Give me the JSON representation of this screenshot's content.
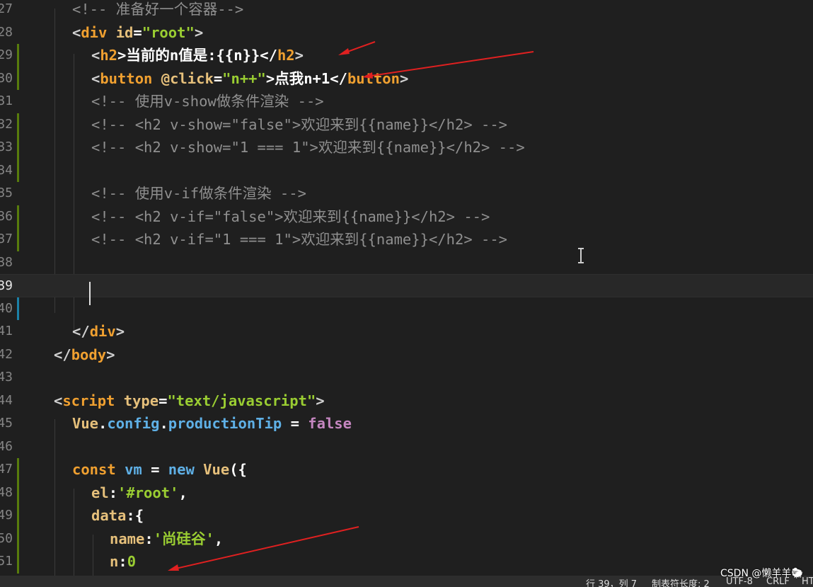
{
  "editor": {
    "lines": [
      {
        "num": "27",
        "tokens": [
          {
            "t": "<!-- 准备好一个容器-->",
            "c": "c"
          }
        ]
      },
      {
        "num": "28",
        "tokens": [
          {
            "t": "<",
            "c": "p"
          },
          {
            "t": "div",
            "c": "t"
          },
          {
            "t": " ",
            "c": "w"
          },
          {
            "t": "id",
            "c": "a"
          },
          {
            "t": "=",
            "c": "w"
          },
          {
            "t": "\"root\"",
            "c": "s"
          },
          {
            "t": ">",
            "c": "p"
          }
        ]
      },
      {
        "num": "29",
        "tokens": [
          {
            "t": "<",
            "c": "p"
          },
          {
            "t": "h2",
            "c": "t"
          },
          {
            "t": ">当前的n值是:{{n}}</",
            "c": "w"
          },
          {
            "t": "h2",
            "c": "t"
          },
          {
            "t": ">",
            "c": "p"
          }
        ]
      },
      {
        "num": "30",
        "tokens": [
          {
            "t": "<",
            "c": "p"
          },
          {
            "t": "button",
            "c": "t"
          },
          {
            "t": " ",
            "c": "w"
          },
          {
            "t": "@click",
            "c": "a"
          },
          {
            "t": "=",
            "c": "w"
          },
          {
            "t": "\"n++\"",
            "c": "s"
          },
          {
            "t": ">点我n+1</",
            "c": "w"
          },
          {
            "t": "button",
            "c": "t"
          },
          {
            "t": ">",
            "c": "p"
          }
        ]
      },
      {
        "num": "31",
        "tokens": [
          {
            "t": "<!-- 使用v-show做条件渲染 -->",
            "c": "c"
          }
        ]
      },
      {
        "num": "32",
        "tokens": [
          {
            "t": "<!-- <h2 v-show=\"false\">欢迎来到{{name}}</h2> -->",
            "c": "c"
          }
        ]
      },
      {
        "num": "33",
        "tokens": [
          {
            "t": "<!-- <h2 v-show=\"1 === 1\">欢迎来到{{name}}</h2> -->",
            "c": "c"
          }
        ]
      },
      {
        "num": "34",
        "tokens": []
      },
      {
        "num": "35",
        "tokens": [
          {
            "t": "<!-- 使用v-if做条件渲染 -->",
            "c": "c"
          }
        ]
      },
      {
        "num": "36",
        "tokens": [
          {
            "t": "<!-- <h2 v-if=\"false\">欢迎来到{{name}}</h2> -->",
            "c": "c"
          }
        ]
      },
      {
        "num": "37",
        "tokens": [
          {
            "t": "<!-- <h2 v-if=\"1 === 1\">欢迎来到{{name}}</h2> -->",
            "c": "c"
          }
        ]
      },
      {
        "num": "38",
        "tokens": []
      },
      {
        "num": "39",
        "tokens": []
      },
      {
        "num": "40",
        "tokens": []
      },
      {
        "num": "41",
        "tokens": [
          {
            "t": "</",
            "c": "p"
          },
          {
            "t": "div",
            "c": "t"
          },
          {
            "t": ">",
            "c": "p"
          }
        ]
      },
      {
        "num": "42",
        "tokens": [
          {
            "t": "</",
            "c": "p"
          },
          {
            "t": "body",
            "c": "t"
          },
          {
            "t": ">",
            "c": "p"
          }
        ]
      },
      {
        "num": "43",
        "tokens": []
      },
      {
        "num": "44",
        "tokens": [
          {
            "t": "<",
            "c": "p"
          },
          {
            "t": "script",
            "c": "t"
          },
          {
            "t": " ",
            "c": "w"
          },
          {
            "t": "type",
            "c": "a"
          },
          {
            "t": "=",
            "c": "w"
          },
          {
            "t": "\"text/javascript\"",
            "c": "s"
          },
          {
            "t": ">",
            "c": "p"
          }
        ]
      },
      {
        "num": "45",
        "tokens": [
          {
            "t": "Vue",
            "c": "a"
          },
          {
            "t": ".",
            "c": "w"
          },
          {
            "t": "config",
            "c": "v"
          },
          {
            "t": ".",
            "c": "w"
          },
          {
            "t": "productionTip",
            "c": "v"
          },
          {
            "t": " = ",
            "c": "w"
          },
          {
            "t": "false",
            "c": "kw"
          }
        ]
      },
      {
        "num": "46",
        "tokens": []
      },
      {
        "num": "47",
        "tokens": [
          {
            "t": "const",
            "c": "k"
          },
          {
            "t": " ",
            "c": "w"
          },
          {
            "t": "vm",
            "c": "v"
          },
          {
            "t": " = ",
            "c": "w"
          },
          {
            "t": "new",
            "c": "v"
          },
          {
            "t": " ",
            "c": "w"
          },
          {
            "t": "Vue",
            "c": "a"
          },
          {
            "t": "({",
            "c": "w"
          }
        ]
      },
      {
        "num": "48",
        "tokens": [
          {
            "t": "el",
            "c": "a"
          },
          {
            "t": ":",
            "c": "w"
          },
          {
            "t": "'#root'",
            "c": "s"
          },
          {
            "t": ",",
            "c": "w"
          }
        ]
      },
      {
        "num": "49",
        "tokens": [
          {
            "t": "data",
            "c": "a"
          },
          {
            "t": ":{",
            "c": "w"
          }
        ]
      },
      {
        "num": "50",
        "tokens": [
          {
            "t": "name",
            "c": "a"
          },
          {
            "t": ":",
            "c": "w"
          },
          {
            "t": "'尚硅谷'",
            "c": "s"
          },
          {
            "t": ",",
            "c": "w"
          }
        ]
      },
      {
        "num": "51",
        "tokens": [
          {
            "t": "n",
            "c": "a"
          },
          {
            "t": ":",
            "c": "w"
          },
          {
            "t": "0",
            "c": "s"
          }
        ]
      }
    ]
  },
  "status": {
    "position": "行 39，列 7",
    "tab_size": "制表符长度: 2",
    "encoding": "UTF-8",
    "eol": "CRLF",
    "language": "HT"
  },
  "watermark": "CSDN @懒羊羊🐑",
  "colors": {
    "background": "#1f1f1f",
    "annotation_arrow": "#e02020",
    "gutter_modified": "#587c0c",
    "gutter_added": "#1b81a8"
  }
}
